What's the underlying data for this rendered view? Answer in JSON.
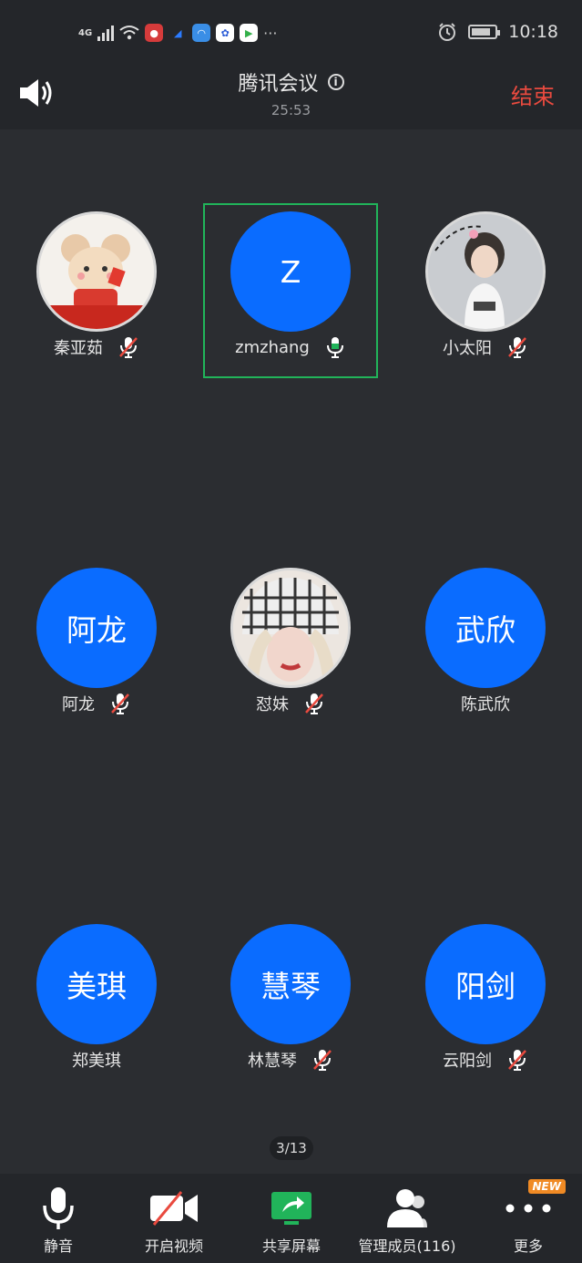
{
  "status_bar": {
    "network": "4G",
    "time": "10:18"
  },
  "header": {
    "title": "腾讯会议",
    "timer": "25:53",
    "end_label": "结束"
  },
  "participants": [
    {
      "display": "",
      "name": "秦亚茹",
      "muted": true,
      "photo": true
    },
    {
      "display": "Z",
      "name": "zmzhang",
      "muted": false,
      "photo": false,
      "active": true
    },
    {
      "display": "",
      "name": "小太阳",
      "muted": true,
      "photo": true
    },
    {
      "display": "阿龙",
      "name": "阿龙",
      "muted": true,
      "photo": false
    },
    {
      "display": "",
      "name": "怼妹",
      "muted": true,
      "photo": true
    },
    {
      "display": "武欣",
      "name": "陈武欣",
      "muted": false,
      "photo": false
    },
    {
      "display": "美琪",
      "name": "郑美琪",
      "muted": false,
      "photo": false
    },
    {
      "display": "慧琴",
      "name": "林慧琴",
      "muted": true,
      "photo": false
    },
    {
      "display": "阳剑",
      "name": "云阳剑",
      "muted": true,
      "photo": false
    }
  ],
  "page_indicator": "3/13",
  "toolbar": {
    "mute_label": "静音",
    "video_label": "开启视频",
    "share_label": "共享屏幕",
    "members_label": "管理成员(116)",
    "more_label": "更多",
    "new_badge": "NEW"
  },
  "colors": {
    "accent": "#0a6cff",
    "end_red": "#e94a3f",
    "active_green": "#21b45a",
    "background": "#2b2d31"
  }
}
